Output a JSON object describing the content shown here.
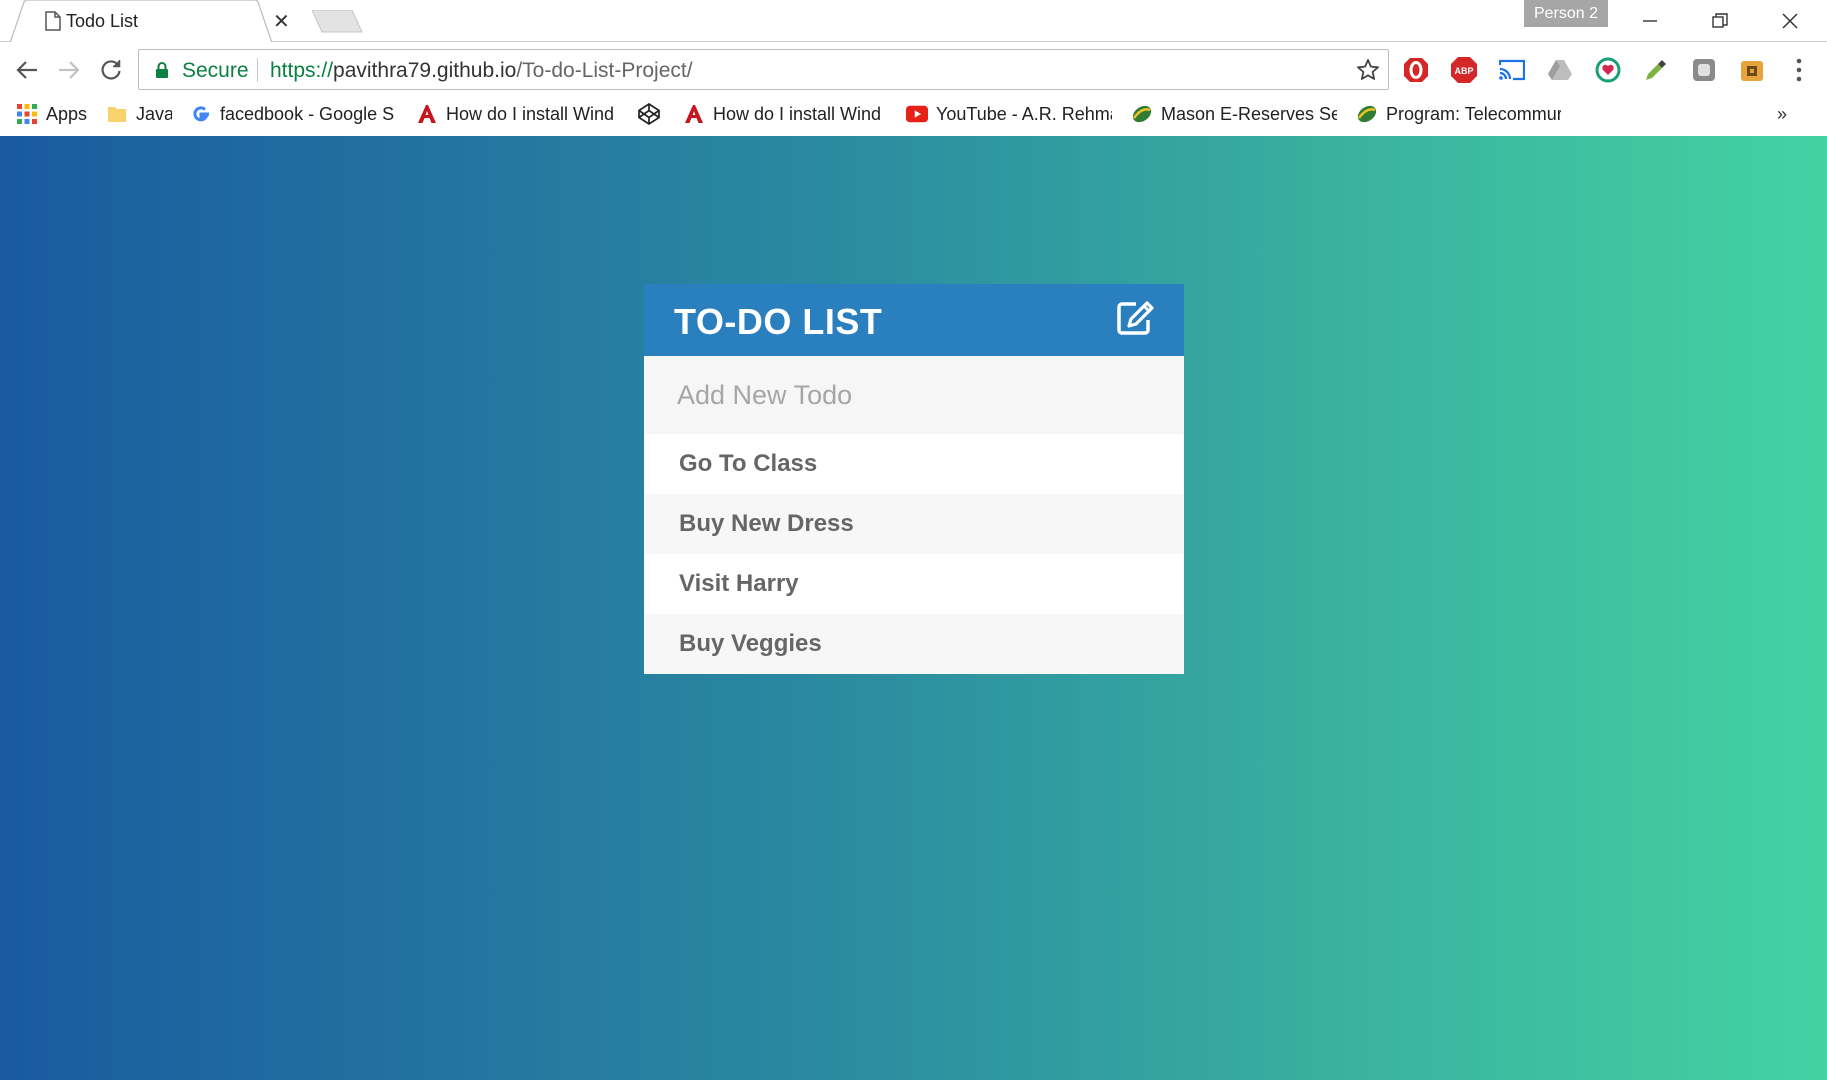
{
  "tab": {
    "title": "Todo List"
  },
  "profile": {
    "label": "Person 2"
  },
  "toolbar": {
    "secure_label": "Secure",
    "url_scheme": "https://",
    "url_host": "pavithra79.github.io",
    "url_path": "/To-do-List-Project/"
  },
  "extensions": [
    "opera-icon",
    "adblock-icon",
    "cast-icon",
    "drive-icon",
    "extension-heart-icon",
    "color-picker-icon",
    "extension-gray-icon",
    "extension-user-icon"
  ],
  "bookmarks": {
    "items": [
      {
        "label": "Apps",
        "icon": "apps-grid-icon"
      },
      {
        "label": "Java",
        "icon": "folder-icon"
      },
      {
        "label": "facedbook - Google S",
        "icon": "google-icon"
      },
      {
        "label": "How do I install Wind",
        "icon": "acrobat-icon"
      },
      {
        "label": "",
        "icon": "codepen-icon"
      },
      {
        "label": "How do I install Wind",
        "icon": "acrobat-icon"
      },
      {
        "label": "YouTube - A.R. Rehma",
        "icon": "youtube-icon"
      },
      {
        "label": "Mason E-Reserves Sea",
        "icon": "mason-icon"
      },
      {
        "label": "Program: Telecommur",
        "icon": "mason-icon"
      }
    ],
    "more": "»"
  },
  "todo": {
    "title": "TO-DO LIST",
    "input_placeholder": "Add New Todo",
    "items": [
      "Go To Class",
      "Buy New Dress",
      "Visit Harry",
      "Buy Veggies"
    ]
  },
  "colors": {
    "header": "#2a7fbf",
    "gradient_start": "#1a5aa0",
    "gradient_end": "#44d2a2",
    "secure_green": "#0b8043"
  }
}
